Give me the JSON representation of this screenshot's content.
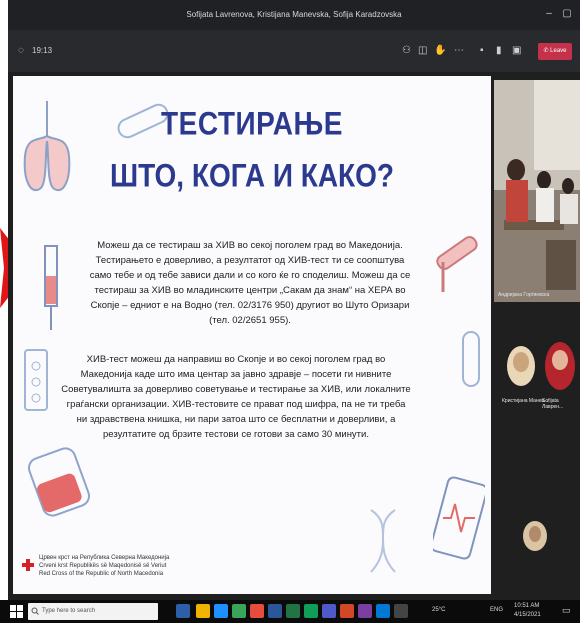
{
  "window": {
    "title": "Sofijata Lavrenova, Kristijana Manevska, Sofija Karadzovska",
    "controls": [
      "minimize",
      "maximize",
      "close"
    ]
  },
  "toolbar": {
    "timer": "19:13",
    "leave_label": "Leave",
    "icons": [
      "camera-icon",
      "mic-icon",
      "share-icon",
      "more-icon",
      "chat-icon",
      "participants-icon",
      "raise-hand-icon"
    ]
  },
  "slide": {
    "title_line1": "ТЕСТИРАЊЕ",
    "title_line2": "ШТО, КОГА И КАКО?",
    "paragraph1": "Можеш да се тестираш за ХИВ во секој поголем град во Македонија. Тестирањето е доверливо, а резултатот од ХИВ-тест ти се соопштува само тебе и од тебе зависи дали и со кого ќе го споделиш. Можеш да се тестираш за ХИВ во младинските центри „Сакам да знам“ на ХЕРА во Скопје – едниот е на Водно (тел. 02/3176 950) другиот во Шуто Оризари (тел. 02/2651 955).",
    "paragraph2": "ХИВ-тест можеш да направиш во Скопје и во секој поголем град во Македонија каде што има центар за јавно здравје – посети ги нивните Советувалишта за доверливо советување и тестирање за ХИВ, или локалните граѓански организации. ХИВ-тестовите се прават под шифра, па не ти треба ни здравствена книшка, ни пари затоа што се бесплатни и доверливи, а резултатите од брзите тестови се готови за само 30 минути.",
    "org_line1": "Црвен крст на Република Северна Македонија",
    "org_line2": "Crveni krst Republikës së Maqedonisë së Veriut",
    "org_line3": "Red Cross of the Republic of North Macedonia"
  },
  "participants": [
    {
      "name": "Андријана Ѓорѓиевска"
    },
    {
      "name": "Кристијана Манев..."
    },
    {
      "name": "Sofijata Лаврен..."
    },
    {
      "name": ""
    }
  ],
  "taskbar": {
    "search_placeholder": "Type here to search",
    "tray_lang": "ENG",
    "tray_time": "10:51 AM",
    "tray_date": "4/15/2021",
    "temperature": "25°C"
  },
  "colors": {
    "title_blue": "#2b3a8e",
    "leave_red": "#c4314b",
    "arrow_red": "#e11515"
  }
}
